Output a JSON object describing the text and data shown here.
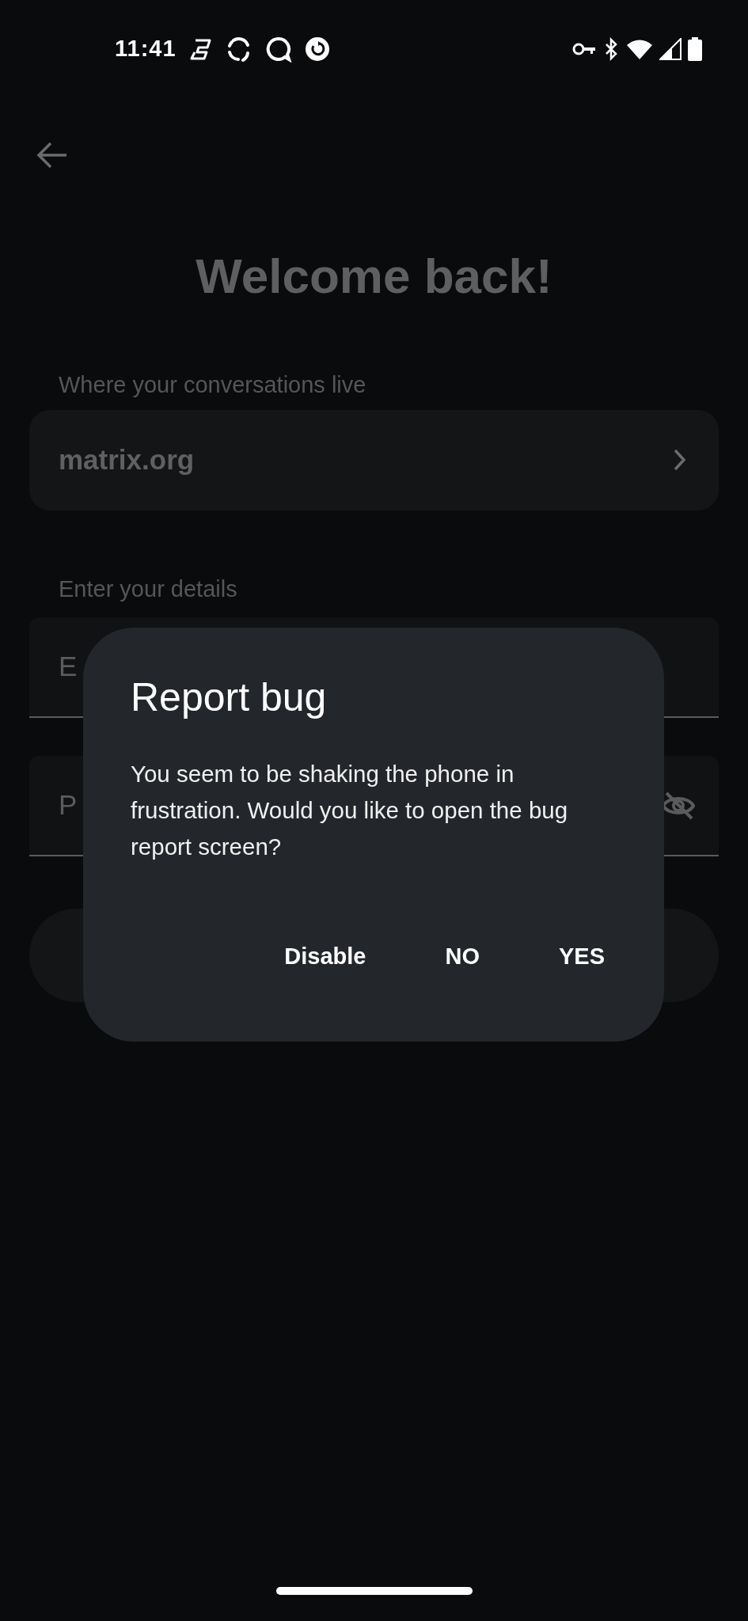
{
  "status_bar": {
    "time": "11:41"
  },
  "header": {
    "title": "Welcome back!"
  },
  "server": {
    "label": "Where your conversations live",
    "value": "matrix.org"
  },
  "details": {
    "label": "Enter your details",
    "fields": [
      {
        "kind": "text",
        "placeholder": "E"
      },
      {
        "kind": "password",
        "placeholder": "P"
      }
    ]
  },
  "dialog": {
    "title": "Report bug",
    "message": "You seem to be shaking the phone in frustration. Would you like to open the bug report screen?",
    "buttons": [
      "Disable",
      "NO",
      "YES"
    ]
  }
}
